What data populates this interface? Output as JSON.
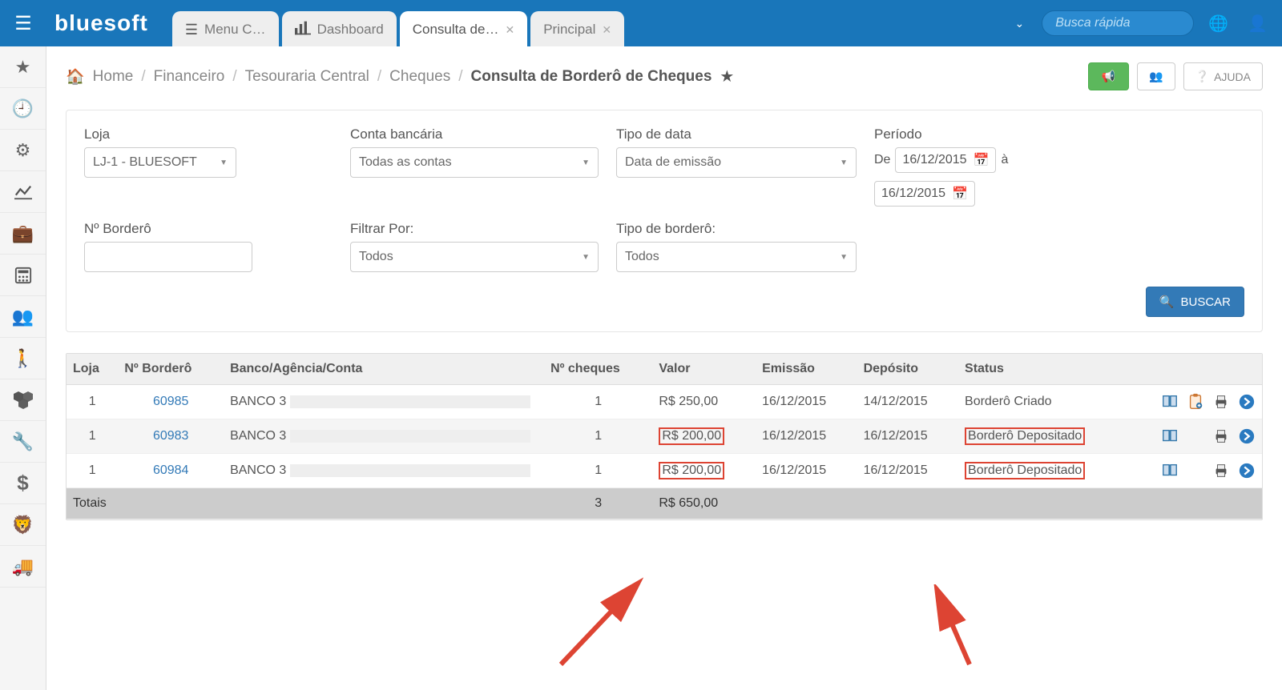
{
  "brand": "bluesoft",
  "search_placeholder": "Busca rápida",
  "tabs": [
    {
      "label": "Menu C…",
      "icon": "list"
    },
    {
      "label": "Dashboard",
      "icon": "bars"
    },
    {
      "label": "Consulta de…",
      "icon": "",
      "active": true,
      "close": true
    },
    {
      "label": "Principal",
      "icon": "",
      "close": true
    }
  ],
  "breadcrumb": {
    "home": "Home",
    "items": [
      "Financeiro",
      "Tesouraria Central",
      "Cheques"
    ],
    "current": "Consulta de Borderô de Cheques"
  },
  "buttons": {
    "help": "AJUDA",
    "search": "BUSCAR"
  },
  "filters": {
    "loja_label": "Loja",
    "loja_value": "LJ-1 - BLUESOFT",
    "conta_label": "Conta bancária",
    "conta_value": "Todas as contas",
    "tipodata_label": "Tipo de data",
    "tipodata_value": "Data de emissão",
    "periodo_label": "Período",
    "periodo_de": "De",
    "periodo_a": "à",
    "date_from": "16/12/2015",
    "date_to": "16/12/2015",
    "nbordero_label": "Nº Borderô",
    "filtrar_label": "Filtrar Por:",
    "filtrar_value": "Todos",
    "tipobordero_label": "Tipo de borderô:",
    "tipobordero_value": "Todos"
  },
  "table": {
    "headers": {
      "loja": "Loja",
      "nbordero": "Nº Borderô",
      "banco": "Banco/Agência/Conta",
      "ncheques": "Nº cheques",
      "valor": "Valor",
      "emissao": "Emissão",
      "deposito": "Depósito",
      "status": "Status"
    },
    "rows": [
      {
        "loja": "1",
        "nbordero": "60985",
        "banco": "BANCO 3",
        "ncheques": "1",
        "valor": "R$ 250,00",
        "emissao": "16/12/2015",
        "deposito": "14/12/2015",
        "status": "Borderô Criado",
        "hl_valor": false,
        "hl_status": false,
        "clip": true
      },
      {
        "loja": "1",
        "nbordero": "60983",
        "banco": "BANCO 3",
        "ncheques": "1",
        "valor": "R$ 200,00",
        "emissao": "16/12/2015",
        "deposito": "16/12/2015",
        "status": "Borderô Depositado",
        "hl_valor": true,
        "hl_status": true,
        "clip": false
      },
      {
        "loja": "1",
        "nbordero": "60984",
        "banco": "BANCO 3",
        "ncheques": "1",
        "valor": "R$ 200,00",
        "emissao": "16/12/2015",
        "deposito": "16/12/2015",
        "status": "Borderô Depositado",
        "hl_valor": true,
        "hl_status": true,
        "clip": false
      }
    ],
    "totals": {
      "label": "Totais",
      "ncheques": "3",
      "valor": "R$ 650,00"
    }
  }
}
